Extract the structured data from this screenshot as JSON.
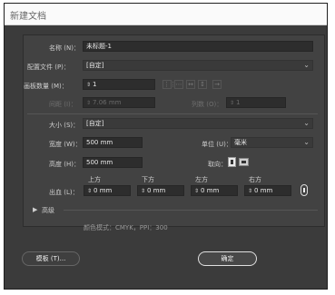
{
  "window": {
    "title": "新建文档"
  },
  "form": {
    "name": {
      "label": "名称 (N)：",
      "value": "未标题-1"
    },
    "profile": {
      "label": "配置文件 (P)：",
      "value": "[自定]"
    },
    "artboards": {
      "label": "画板数量 (M)：",
      "value": "1"
    },
    "spacing": {
      "label": "间距 (I)：",
      "value": "7.06 mm"
    },
    "columns": {
      "label": "列数 (O)：",
      "value": "1"
    },
    "size": {
      "label": "大小 (S)：",
      "value": "[自定]"
    },
    "width": {
      "label": "宽度 (W)：",
      "value": "500 mm"
    },
    "units": {
      "label": "单位 (U)：",
      "value": "毫米"
    },
    "height": {
      "label": "高度 (H)：",
      "value": "500 mm"
    },
    "orientation": {
      "label": "取向："
    },
    "bleed": {
      "label": "出血 (L)：",
      "top": {
        "label": "上方",
        "value": "0 mm"
      },
      "bottom": {
        "label": "下方",
        "value": "0 mm"
      },
      "left": {
        "label": "左方",
        "value": "0 mm"
      },
      "right": {
        "label": "右方",
        "value": "0 mm"
      }
    },
    "advanced": {
      "label": "高级"
    },
    "color_mode_info": "颜色模式：CMYK，PPI：300"
  },
  "footer": {
    "template_button": "模板 (T)...",
    "ok_button": "确定"
  },
  "icons": {
    "spin": "updown-arrows-icon",
    "dropdown": "chevron-down-icon",
    "grid_by_row": "grid-by-row-icon",
    "grid_by_column": "grid-by-column-icon",
    "arrange_row": "arrange-row-icon",
    "arrange_column": "arrange-column-icon",
    "arrow_right": "arrow-right-icon",
    "portrait": "portrait-icon",
    "landscape": "landscape-icon",
    "link": "link-icon",
    "disclosure": "triangle-right-icon"
  }
}
